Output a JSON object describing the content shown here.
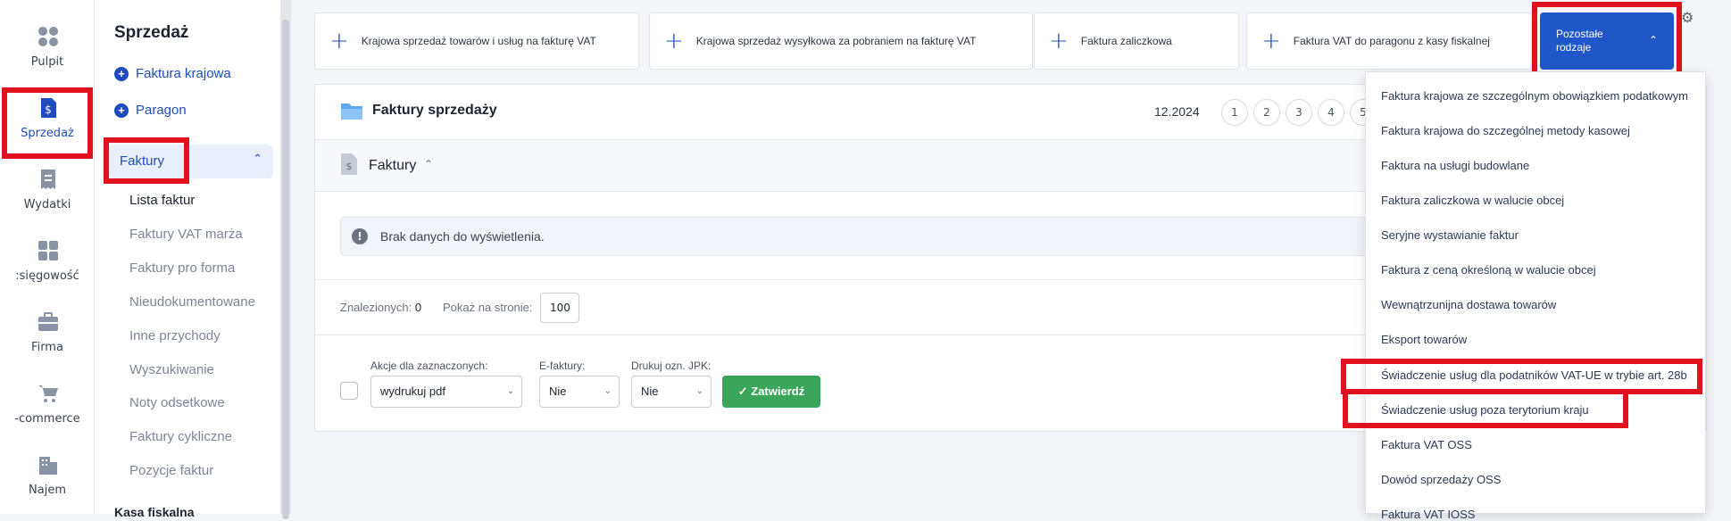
{
  "rail": {
    "items": [
      {
        "label": "Pulpit",
        "icon": "grid-icon"
      },
      {
        "label": "Sprzedaż",
        "icon": "invoice-dollar-icon",
        "active": true
      },
      {
        "label": "Wydatki",
        "icon": "receipt-icon"
      },
      {
        "label": ":sięgowość",
        "icon": "calculator-icon"
      },
      {
        "label": "Firma",
        "icon": "briefcase-icon"
      },
      {
        "label": "-commerce",
        "icon": "cart-icon"
      },
      {
        "label": "Najem",
        "icon": "building-icon"
      }
    ]
  },
  "sidebar": {
    "title": "Sprzedaż",
    "links": [
      "Faktura krajowa",
      "Paragon"
    ],
    "group": "Faktury",
    "subitems": [
      "Lista faktur",
      "Faktury VAT marża",
      "Faktury pro forma",
      "Nieudokumentowane",
      "Inne przychody",
      "Wyszukiwanie",
      "Noty odsetkowe",
      "Faktury cykliczne",
      "Pozycje faktur"
    ],
    "next_group": "Kasa fiskalna"
  },
  "top_actions": [
    "Krajowa sprzedaż towarów i usług na fakturę VAT",
    "Krajowa sprzedaż wysyłkowa za pobraniem na fakturę VAT",
    "Faktura zaliczkowa",
    "Faktura VAT do paragonu z kasy fiskalnej"
  ],
  "more_button": "Pozostałe rodzaje",
  "panel": {
    "title": "Faktury sprzedaży",
    "period": "12.2024",
    "pages": [
      "1",
      "2",
      "3",
      "4",
      "5"
    ],
    "section": "Faktury",
    "empty": "Brak danych do wyświetlenia.",
    "found_label": "Znalezionych:",
    "found_count": "0",
    "perpage_label": "Pokaż na stronie:",
    "perpage_value": "100",
    "bulk_label": "Akcje dla zaznaczonych:",
    "bulk_value": "wydrukuj pdf",
    "efaktury_label": "E-faktury:",
    "efaktury_value": "Nie",
    "jpk_label": "Drukuj ozn. JPK:",
    "jpk_value": "Nie",
    "confirm_label": "Zatwierdź"
  },
  "dropdown": {
    "items": [
      "Faktura krajowa ze szczególnym obowiązkiem podatkowym",
      "Faktura krajowa do szczególnej metody kasowej",
      "Faktura na usługi budowlane",
      "Faktura zaliczkowa w walucie obcej",
      "Seryjne wystawianie faktur",
      "Faktura z ceną określoną w walucie obcej",
      "Wewnątrzunijna dostawa towarów",
      "Eksport towarów",
      "Świadczenie usług dla podatników VAT-UE w trybie art. 28b",
      "Świadczenie usług poza terytorium kraju",
      "Faktura VAT OSS",
      "Dowód sprzedaży OSS",
      "Faktura VAT IOSS"
    ]
  },
  "colors": {
    "accent": "#1f57c8",
    "highlight": "#e0121f",
    "success": "#3aa55b"
  }
}
